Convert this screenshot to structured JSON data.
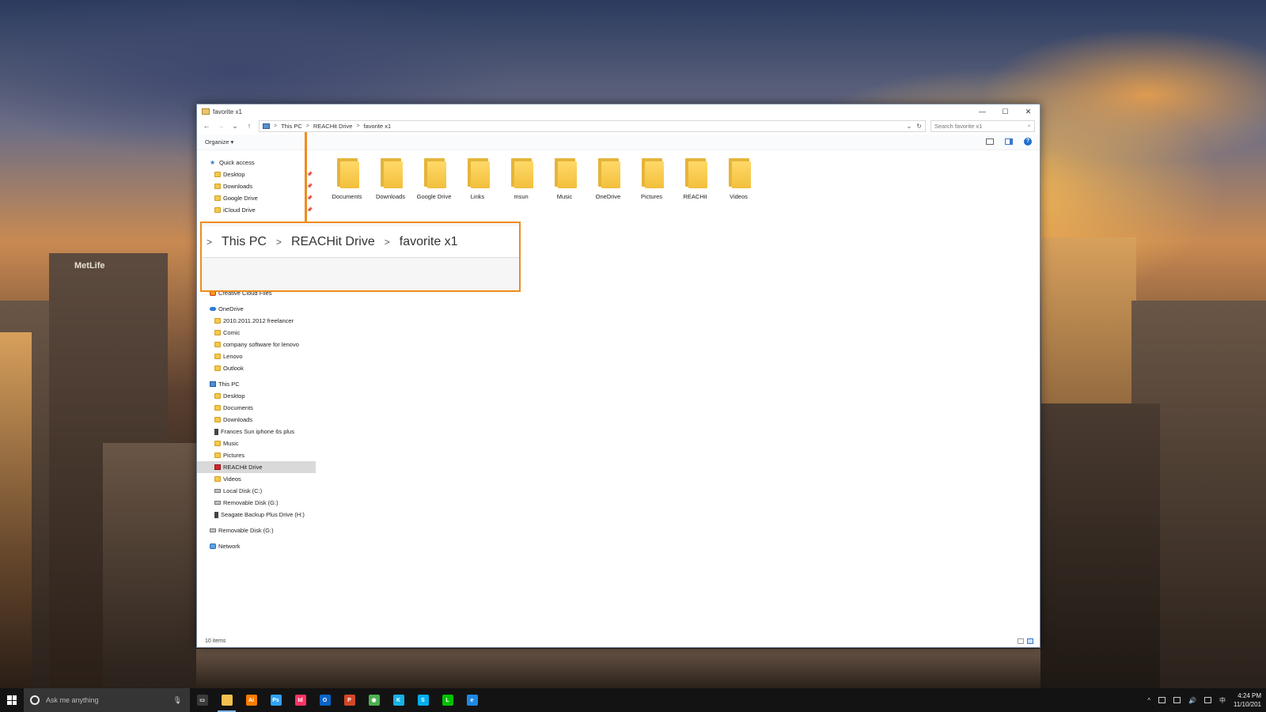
{
  "desktop": {
    "building_sign": "MetLife"
  },
  "window": {
    "title": "favorite x1",
    "controls": {
      "minimize": "—",
      "maximize": "☐",
      "close": "✕"
    }
  },
  "address": {
    "back": "←",
    "forward": "→",
    "recent": "⌄",
    "up": "↑",
    "crumbs": [
      "This PC",
      "REACHit Drive",
      "favorite x1"
    ],
    "separator": ">",
    "dropdown": "⌄",
    "refresh": "↻"
  },
  "search": {
    "placeholder": "Search favorite x1",
    "icon": "⌕"
  },
  "commandbar": {
    "organize": "Organize ▾",
    "help": "?"
  },
  "navpane": {
    "quick_access": "Quick access",
    "quick_items": [
      "Desktop",
      "Downloads",
      "Google Drive",
      "iCloud Drive"
    ],
    "creative_cloud": "Creative Cloud Files",
    "onedrive": "OneDrive",
    "onedrive_items": [
      "2010.2011.2012 freelancer",
      "Comic",
      "company software for lenovo",
      "Lenovo",
      "Outlook"
    ],
    "this_pc": "This PC",
    "this_pc_items": [
      "Desktop",
      "Documents",
      "Downloads",
      "Frances Sun iphone 6s plus",
      "Music",
      "Pictures",
      "REACHit Drive",
      "Videos",
      "Local Disk (C:)",
      "Removable Disk (G:)",
      "Seagate Backup Plus Drive (H:)"
    ],
    "removable": "Removable Disk (G:)",
    "network": "Network",
    "selected": "REACHit Drive"
  },
  "files": [
    "Documents",
    "Downloads",
    "Google Drive",
    "Links",
    "msun",
    "Music",
    "OneDrive",
    "Pictures",
    "REACHit",
    "Videos"
  ],
  "status": {
    "count": "10 items"
  },
  "callout": {
    "crumbs": [
      "This PC",
      "REACHit Drive",
      "favorite x1"
    ],
    "separator": ">"
  },
  "taskbar": {
    "search_placeholder": "Ask me anything",
    "mic": "🎙",
    "apps": [
      {
        "name": "task-view",
        "label": "▭",
        "color": "#3a3a3a"
      },
      {
        "name": "file-explorer",
        "label": "",
        "color": "#f2c14e"
      },
      {
        "name": "illustrator",
        "label": "Ai",
        "color": "#ff7c00"
      },
      {
        "name": "photoshop",
        "label": "Ps",
        "color": "#2fa3f7"
      },
      {
        "name": "indesign",
        "label": "Id",
        "color": "#ff3366"
      },
      {
        "name": "outlook",
        "label": "O",
        "color": "#0a64c8"
      },
      {
        "name": "powerpoint",
        "label": "P",
        "color": "#d24726"
      },
      {
        "name": "chrome",
        "label": "◉",
        "color": "#4caf50"
      },
      {
        "name": "kodi",
        "label": "K",
        "color": "#17b2e7"
      },
      {
        "name": "skype",
        "label": "S",
        "color": "#00aff0"
      },
      {
        "name": "line",
        "label": "L",
        "color": "#00c300"
      },
      {
        "name": "edge",
        "label": "e",
        "color": "#1e88e5"
      }
    ],
    "time": "4:24 PM",
    "date": "11/10/201"
  }
}
